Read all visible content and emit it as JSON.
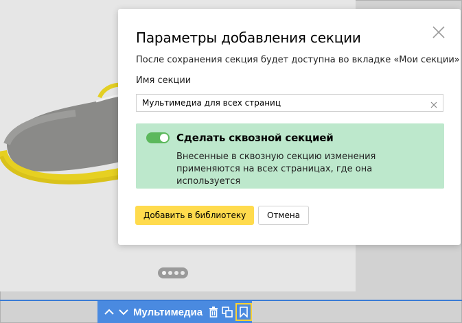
{
  "modal": {
    "title": "Параметры добавления секции",
    "description": "После сохранения секция будет доступна во вкладке «Мои секции»",
    "name_label": "Имя секции",
    "name_value": "Мультимедиа для всех страниц",
    "sticky": {
      "title": "Сделать сквозной секцией",
      "description": "Внесенные в сквозную секцию изменения применяются на всех страницах, где она используется",
      "enabled": true
    },
    "add_button": "Добавить в библиотеку",
    "cancel_button": "Отмена"
  },
  "toolbar": {
    "title": "Мультимедиа"
  },
  "carousel": {
    "slides": 4,
    "active": 1
  },
  "icons": {
    "close": "close-icon",
    "clear": "clear-input-icon",
    "up": "chevron-up-icon",
    "down": "chevron-down-icon",
    "delete": "trash-icon",
    "copy": "copy-icon",
    "save": "bookmark-icon"
  },
  "colors": {
    "accent_blue": "#4a8ae0",
    "accent_yellow": "#ffdb4d",
    "toggle_green": "#5cb85c",
    "sticky_bg": "#bde8cc"
  }
}
